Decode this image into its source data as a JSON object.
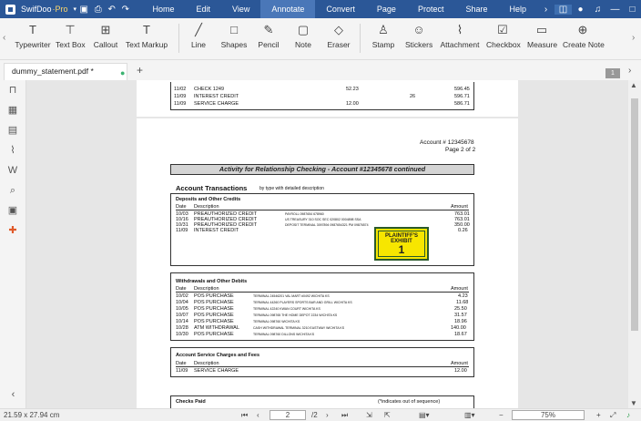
{
  "app": {
    "name": "SwifDoo",
    "edition": "·Pro"
  },
  "menus": [
    "Home",
    "Edit",
    "View",
    "Annotate",
    "Convert",
    "Page",
    "Protect",
    "Share",
    "Help"
  ],
  "tools": [
    "Typewriter",
    "Text Box",
    "Callout",
    "Text Markup",
    "Line",
    "Shapes",
    "Pencil",
    "Note",
    "Eraser",
    "Stamp",
    "Stickers",
    "Attachment",
    "Checkbox",
    "Measure",
    "Create Note"
  ],
  "tab": {
    "title": "dummy_statement.pdf *"
  },
  "page_badge": "1",
  "doc": {
    "top_rows": [
      [
        "11/02",
        "CHECK 1249",
        "52.23",
        "",
        "596.45"
      ],
      [
        "11/09",
        "INTEREST CREDIT",
        "",
        "26",
        "596.71"
      ],
      [
        "11/09",
        "SERVICE CHARGE",
        "12.00",
        "",
        "586.71"
      ]
    ],
    "account": "Account # 12345678",
    "page_of": "Page 2 of 2",
    "activity_title": "Activity for Relationship Checking - Account #12345678 continued",
    "transactions_title": "Account Transactions",
    "transactions_sub": "by type with detailed description",
    "deposits": {
      "title": "Deposits and Other Credits",
      "headers": [
        "Date",
        "Description",
        "Amount"
      ],
      "rows": [
        [
          "10/03",
          "PREAUTHORIZED CREDIT",
          "PAYROLL 0987654 678960",
          "763.01"
        ],
        [
          "10/16",
          "PREAUTHORIZED CREDIT",
          "US TREASURY 310 SOC SEC 020802 0004898 SSA",
          "763.01"
        ],
        [
          "10/31",
          "PREAUTHORIZED CREDIT",
          "DEPOSIT TERMINAL 3097894 0987654321 PM 09876574",
          "350.00"
        ],
        [
          "11/09",
          "INTEREST CREDIT",
          "",
          "0.26"
        ]
      ]
    },
    "stamp": {
      "line1": "PLAINTIFF'S",
      "line2": "EXHIBIT",
      "number": "1"
    },
    "withdrawals": {
      "title": "Withdrawals and Other Debits",
      "headers": [
        "Date",
        "Description",
        "Amount"
      ],
      "rows": [
        [
          "10/02",
          "POS PURCHASE",
          "TERMINAL 24546201 VAL MART #0492 WICHITA KS",
          "4.23"
        ],
        [
          "10/04",
          "POS PURCHASE",
          "TERMINAL 44260 PLAYERS SPORTS BAR AND GRILL WICHITA KS",
          "11.68"
        ],
        [
          "10/05",
          "POS PURCHASE",
          "TERMINAL 42240 KWAN COURT WICHITA KS",
          "25.50"
        ],
        [
          "10/07",
          "POS PURCHASE",
          "TERMINAL 098765 THE HOME DEPOT 2234 WICHITA KS",
          "31.57"
        ],
        [
          "10/14",
          "POS PURCHASE",
          "TERMINAL 098760 WICHITA KS",
          "18.96"
        ],
        [
          "10/28",
          "ATM WITHDRAWAL",
          "CASH WITHDRAWAL TERMINAL 3210 EASTWAY WICHITA KS",
          "140.00"
        ],
        [
          "10/30",
          "POS PURCHASE",
          "TERMINAL 098760 DILLONS WICHITA KS",
          "18.67"
        ]
      ]
    },
    "service": {
      "title": "Account Service Charges and Fees",
      "headers": [
        "Date",
        "Description",
        "Amount"
      ],
      "rows": [
        [
          "11/09",
          "SERVICE CHARGE",
          "12.00"
        ]
      ]
    },
    "checks": {
      "title": "Checks Paid",
      "note": "(*indicates out of sequence)"
    }
  },
  "status": {
    "size": "21.59 x 27.94 cm",
    "page": "2",
    "total": "/2",
    "zoom": "75%"
  }
}
